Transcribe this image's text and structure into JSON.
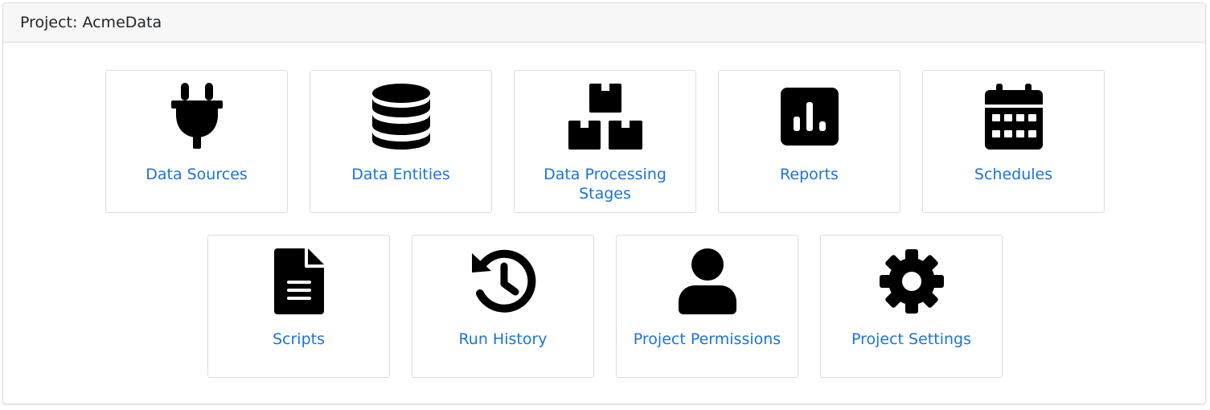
{
  "project": {
    "title": "Project: AcmeData"
  },
  "colors": {
    "link": "#1a73d9",
    "icon": "#000000",
    "header_bg": "#f7f7f7",
    "border": "#dcdcdc"
  },
  "tiles": [
    {
      "label": "Data Sources",
      "icon": "plug-icon"
    },
    {
      "label": "Data Entities",
      "icon": "database-icon"
    },
    {
      "label": "Data Processing Stages",
      "icon": "boxes-stacked-icon"
    },
    {
      "label": "Reports",
      "icon": "chart-square-icon"
    },
    {
      "label": "Schedules",
      "icon": "calendar-icon"
    },
    {
      "label": "Scripts",
      "icon": "file-lines-icon"
    },
    {
      "label": "Run History",
      "icon": "clock-rotate-left-icon"
    },
    {
      "label": "Project Permissions",
      "icon": "user-icon"
    },
    {
      "label": "Project Settings",
      "icon": "gear-icon"
    }
  ]
}
